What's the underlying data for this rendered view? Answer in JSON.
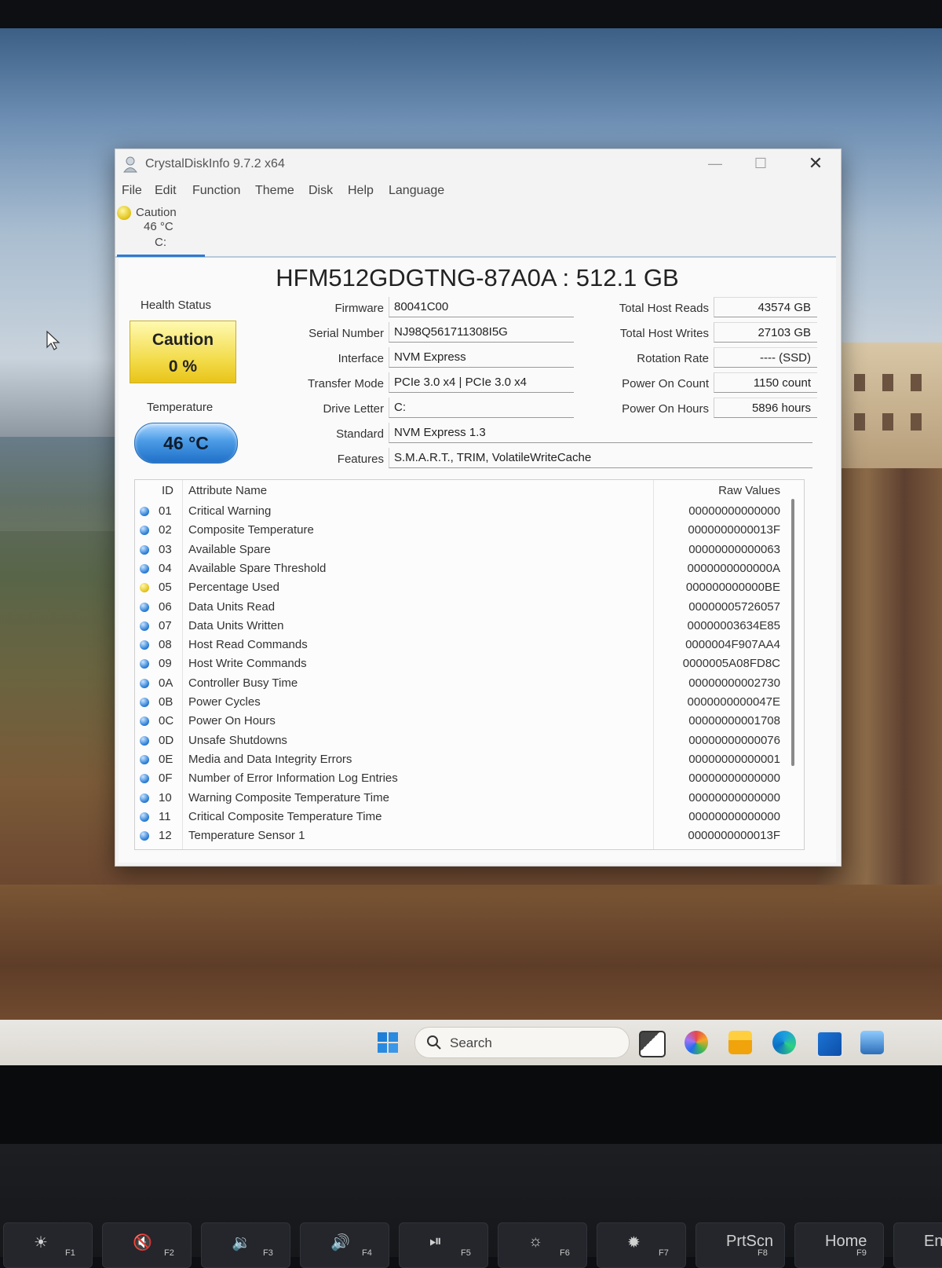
{
  "window": {
    "title": "CrystalDiskInfo 9.7.2 x64",
    "controls": {
      "minimize": "—",
      "maximize": "☐",
      "close": "✕"
    }
  },
  "menu": [
    "File",
    "Edit",
    "Function",
    "Theme",
    "Disk",
    "Help",
    "Language"
  ],
  "disk_tab": {
    "status": "Caution",
    "temp": "46 °C",
    "drive": "C:"
  },
  "model": "HFM512GDGTNG-87A0A : 512.1 GB",
  "health": {
    "label": "Health Status",
    "status": "Caution",
    "percent": "0 %"
  },
  "temperature": {
    "label": "Temperature",
    "value": "46 °C"
  },
  "info": {
    "firmware": {
      "label": "Firmware",
      "value": "80041C00"
    },
    "serial": {
      "label": "Serial Number",
      "value": "NJ98Q561711308I5G"
    },
    "interface": {
      "label": "Interface",
      "value": "NVM Express"
    },
    "transfer": {
      "label": "Transfer Mode",
      "value": "PCIe 3.0 x4 | PCIe 3.0 x4"
    },
    "drive_letter": {
      "label": "Drive Letter",
      "value": "C:"
    },
    "standard": {
      "label": "Standard",
      "value": "NVM Express 1.3"
    },
    "features": {
      "label": "Features",
      "value": "S.M.A.R.T., TRIM, VolatileWriteCache"
    }
  },
  "stats": {
    "reads": {
      "label": "Total Host Reads",
      "value": "43574 GB"
    },
    "writes": {
      "label": "Total Host Writes",
      "value": "27103 GB"
    },
    "rotation": {
      "label": "Rotation Rate",
      "value": "---- (SSD)"
    },
    "power_count": {
      "label": "Power On Count",
      "value": "1150 count"
    },
    "power_hours": {
      "label": "Power On Hours",
      "value": "5896 hours"
    }
  },
  "smart": {
    "headers": {
      "id": "ID",
      "name": "Attribute Name",
      "raw": "Raw Values"
    },
    "rows": [
      {
        "status": "blue",
        "id": "01",
        "name": "Critical Warning",
        "raw": "00000000000000"
      },
      {
        "status": "blue",
        "id": "02",
        "name": "Composite Temperature",
        "raw": "0000000000013F"
      },
      {
        "status": "blue",
        "id": "03",
        "name": "Available Spare",
        "raw": "00000000000063"
      },
      {
        "status": "blue",
        "id": "04",
        "name": "Available Spare Threshold",
        "raw": "0000000000000A"
      },
      {
        "status": "yellow",
        "id": "05",
        "name": "Percentage Used",
        "raw": "000000000000BE"
      },
      {
        "status": "blue",
        "id": "06",
        "name": "Data Units Read",
        "raw": "00000005726057"
      },
      {
        "status": "blue",
        "id": "07",
        "name": "Data Units Written",
        "raw": "00000003634E85"
      },
      {
        "status": "blue",
        "id": "08",
        "name": "Host Read Commands",
        "raw": "0000004F907AA4"
      },
      {
        "status": "blue",
        "id": "09",
        "name": "Host Write Commands",
        "raw": "0000005A08FD8C"
      },
      {
        "status": "blue",
        "id": "0A",
        "name": "Controller Busy Time",
        "raw": "00000000002730"
      },
      {
        "status": "blue",
        "id": "0B",
        "name": "Power Cycles",
        "raw": "0000000000047E"
      },
      {
        "status": "blue",
        "id": "0C",
        "name": "Power On Hours",
        "raw": "00000000001708"
      },
      {
        "status": "blue",
        "id": "0D",
        "name": "Unsafe Shutdowns",
        "raw": "00000000000076"
      },
      {
        "status": "blue",
        "id": "0E",
        "name": "Media and Data Integrity Errors",
        "raw": "00000000000001"
      },
      {
        "status": "blue",
        "id": "0F",
        "name": "Number of Error Information Log Entries",
        "raw": "00000000000000"
      },
      {
        "status": "blue",
        "id": "10",
        "name": "Warning Composite Temperature Time",
        "raw": "00000000000000"
      },
      {
        "status": "blue",
        "id": "11",
        "name": "Critical Composite Temperature Time",
        "raw": "00000000000000"
      },
      {
        "status": "blue",
        "id": "12",
        "name": "Temperature Sensor 1",
        "raw": "0000000000013F"
      }
    ]
  },
  "taskbar": {
    "search_text": "Search",
    "icons": [
      "start-icon",
      "task-view-icon",
      "copilot-icon",
      "file-explorer-icon",
      "edge-icon",
      "store-icon",
      "photos-icon"
    ]
  },
  "keyboard": {
    "keys": [
      {
        "symbol": "☀",
        "fn": "F1"
      },
      {
        "symbol": "🔇",
        "fn": "F2"
      },
      {
        "symbol": "🔉",
        "fn": "F3"
      },
      {
        "symbol": "🔊",
        "fn": "F4"
      },
      {
        "symbol": "⏯",
        "fn": "F5"
      },
      {
        "symbol": "☼",
        "fn": "F6"
      },
      {
        "symbol": "✹",
        "fn": "F7"
      },
      {
        "symbol": "PrtScn",
        "fn": "F8"
      },
      {
        "symbol": "Home",
        "fn": "F9"
      },
      {
        "symbol": "En",
        "fn": ""
      }
    ]
  },
  "colors": {
    "caution": "#f0d43a",
    "good": "#2d7fd6",
    "accent": "#2f7ad1"
  }
}
